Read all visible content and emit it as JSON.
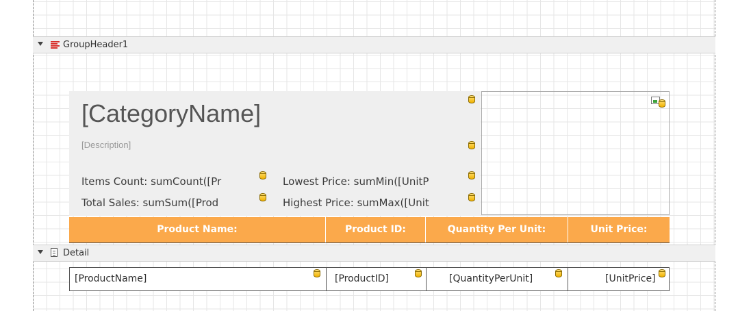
{
  "bands": {
    "group_header": {
      "label": "GroupHeader1"
    },
    "detail": {
      "label": "Detail"
    }
  },
  "category": {
    "name": "[CategoryName]",
    "description": "[Description]",
    "items_count": "Items Count: sumCount([Pr",
    "total_sales": "Total Sales: sumSum([Prod",
    "lowest_price": "Lowest Price: sumMin([UnitP",
    "highest_price": "Highest Price: sumMax([Unit"
  },
  "table_header": {
    "columns": [
      "Product Name:",
      "Product ID:",
      "Quantity Per Unit:",
      "Unit Price:"
    ]
  },
  "detail_row": {
    "cells": [
      "[ProductName]",
      "[ProductID]",
      "[QuantityPerUnit]",
      "[UnitPrice]"
    ]
  },
  "colors": {
    "header_orange": "#fba94b",
    "panel_gray": "#efefef",
    "band_gray": "#f0f0f0"
  },
  "icons": [
    "collapse-arrow-icon",
    "group-header-icon",
    "detail-band-icon",
    "database-icon",
    "picture-icon"
  ]
}
